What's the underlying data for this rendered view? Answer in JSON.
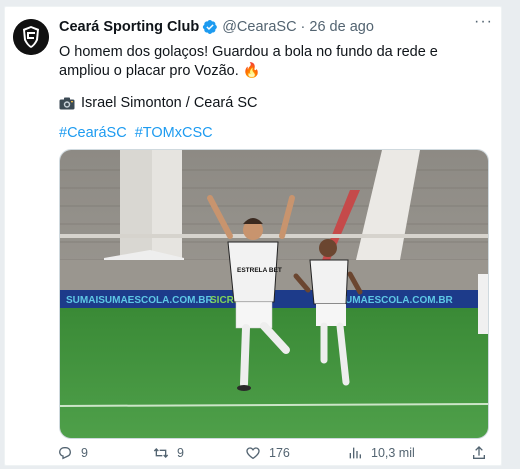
{
  "account": {
    "display_name": "Ceará Sporting Club",
    "handle": "@CearaSC",
    "separator": "·",
    "date": "26 de ago"
  },
  "tweet": {
    "text": "O homem dos golaços! Guardou a bola no fundo da rede e ampliou o placar pro Vozão. 🔥",
    "photo_credit": "Israel Simonton / Ceará SC",
    "hashtags": [
      "#CearáSC",
      "#TOMxCSC"
    ]
  },
  "media": {
    "ad_boards": [
      "SUMAISUMAESCOLA.COM.BR",
      "SICREDI",
      "MAISUMAESCOLA.COM.BR"
    ],
    "jersey_sponsor": "ESTRELA BET"
  },
  "actions": {
    "replies": "9",
    "retweets": "9",
    "likes": "176",
    "views": "10,3 mil"
  },
  "icons": {
    "verified": "verified-badge-icon",
    "camera": "camera-icon",
    "reply": "reply-icon",
    "retweet": "retweet-icon",
    "like": "heart-icon",
    "views": "views-chart-icon",
    "share": "share-icon"
  },
  "colors": {
    "link": "#1d9bf0",
    "secondary_text": "#536471",
    "pitch": "#3f8f3a"
  }
}
